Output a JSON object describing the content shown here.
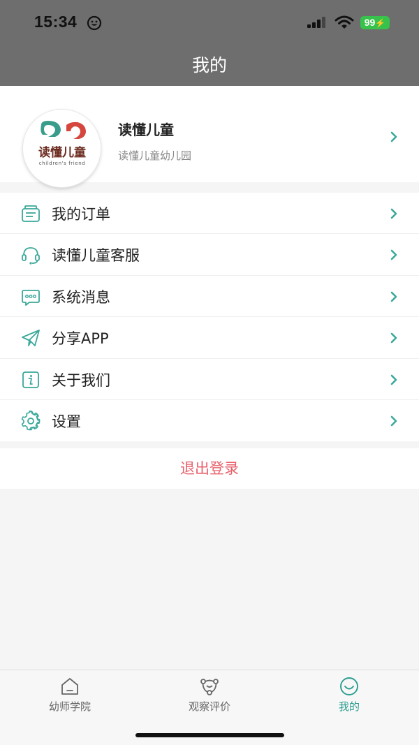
{
  "status_bar": {
    "time": "15:34",
    "battery": "99"
  },
  "header": {
    "title": "我的"
  },
  "profile": {
    "name": "读懂儿童",
    "subtitle": "读懂儿童幼儿园",
    "logo_text": "读懂儿童",
    "logo_subtext": "children's friend"
  },
  "menu": {
    "items": [
      {
        "label": "我的订单",
        "icon": "order-list-icon"
      },
      {
        "label": "读懂儿童客服",
        "icon": "headset-icon"
      },
      {
        "label": "系统消息",
        "icon": "message-icon"
      },
      {
        "label": "分享APP",
        "icon": "paper-plane-icon"
      },
      {
        "label": "关于我们",
        "icon": "info-icon"
      },
      {
        "label": "设置",
        "icon": "gear-icon"
      }
    ]
  },
  "logout": {
    "label": "退出登录"
  },
  "tabbar": {
    "tabs": [
      {
        "label": "幼师学院",
        "icon": "house-icon",
        "active": false
      },
      {
        "label": "观察评价",
        "icon": "nodes-icon",
        "active": false
      },
      {
        "label": "我的",
        "icon": "smile-icon",
        "active": true
      }
    ]
  },
  "colors": {
    "accent": "#2a9d8f",
    "logout": "#e8616b",
    "header_bg": "#6e6e6e",
    "battery": "#37c24b"
  }
}
